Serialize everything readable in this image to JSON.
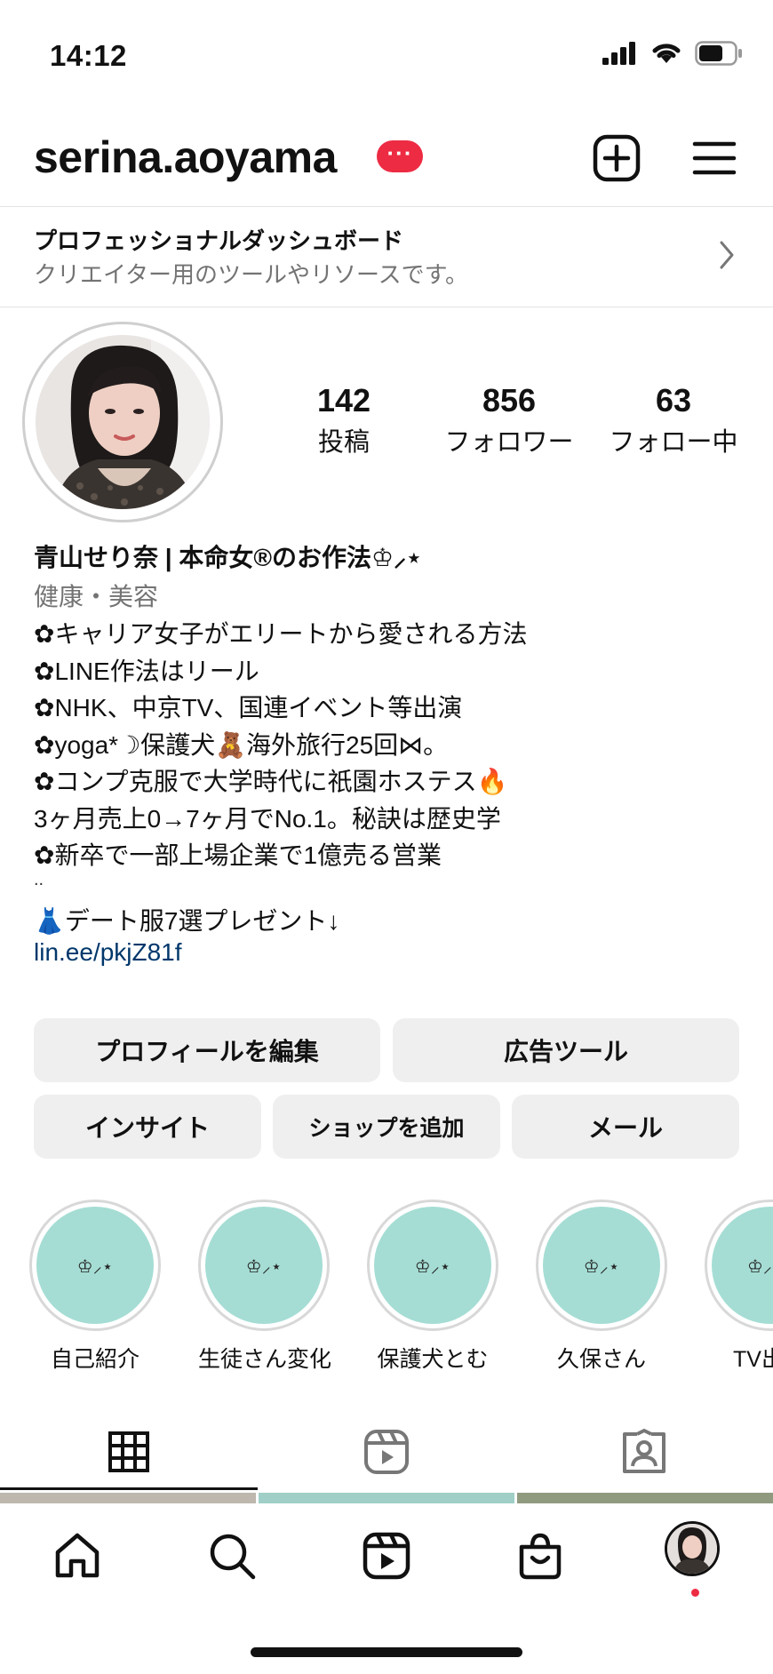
{
  "status_bar": {
    "time": "14:12"
  },
  "header": {
    "username": "serina.aoyama",
    "badge": "···"
  },
  "dashboard": {
    "title": "プロフェッショナルダッシュボード",
    "subtitle": "クリエイター用のツールやリソースです。"
  },
  "stats": {
    "posts": {
      "value": "142",
      "label": "投稿"
    },
    "followers": {
      "value": "856",
      "label": "フォロワー"
    },
    "following": {
      "value": "63",
      "label": "フォロー中"
    }
  },
  "bio": {
    "name": "青山せり奈 | 本命女®のお作法♔⸝⋆",
    "category": "健康・美容",
    "lines": [
      "✿キャリア女子がエリートから愛される方法",
      "✿LINE作法はリール",
      "✿NHK、中京TV、国連イベント等出演",
      "✿yoga*☽保護犬🧸海外旅行25回⋈。",
      "✿コンプ克服で大学時代に祇園ホステス🔥",
      "3ヶ月売上0→7ヶ月でNo.1。秘訣は歴史学",
      "✿新卒で一部上場企業で1億売る営業"
    ],
    "dots": "..",
    "gift_line": "👗デート服7選プレゼント↓",
    "link": "lin.ee/pkjZ81f"
  },
  "buttons": {
    "edit_profile": "プロフィールを編集",
    "ad_tools": "広告ツール",
    "insights": "インサイト",
    "add_shop": "ショップを追加",
    "email": "メール"
  },
  "highlights": [
    {
      "icon_text": "♔⸝⋆",
      "label": "自己紹介"
    },
    {
      "icon_text": "♔⸝⋆",
      "label": "生徒さん変化"
    },
    {
      "icon_text": "♔⸝⋆",
      "label": "保護犬とむ"
    },
    {
      "icon_text": "♔⸝⋆",
      "label": "久保さん"
    },
    {
      "icon_text": "♔⸝",
      "label": "TV出"
    }
  ],
  "colors": {
    "badge": "#ed2b43",
    "highlight_fill": "#a5ddd4",
    "link": "#00376b",
    "button_bg": "#efefef"
  },
  "icons": {
    "header": [
      "plus-square-icon",
      "hamburger-menu-icon"
    ],
    "tabs": [
      "grid-icon",
      "reels-icon",
      "tagged-icon"
    ],
    "nav": [
      "home-icon",
      "search-icon",
      "reels-icon",
      "shop-icon",
      "profile-avatar"
    ]
  }
}
